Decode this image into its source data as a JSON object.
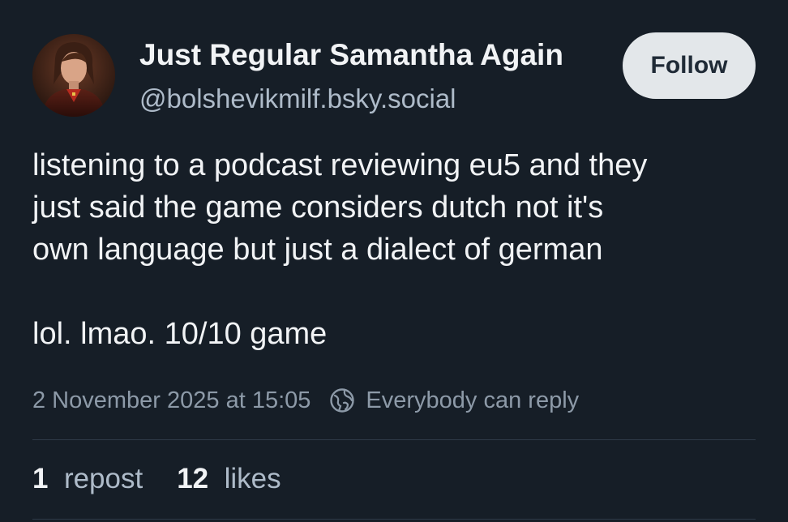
{
  "author": {
    "display_name": "Just Regular Samantha Again",
    "handle": "@bolshevikmilf.bsky.social"
  },
  "follow_label": "Follow",
  "post": {
    "paragraphs": [
      "listening to a podcast reviewing eu5 and they\njust said the game considers dutch not it's\nown language but just a dialect of german",
      "lol. lmao. 10/10 game"
    ],
    "timestamp": "2 November 2025 at 15:05",
    "reply_setting": "Everybody can reply"
  },
  "stats": {
    "reposts_count": "1",
    "reposts_label": "repost",
    "likes_count": "12",
    "likes_label": "likes"
  },
  "icons": {
    "reply_setting": "globe-icon"
  },
  "colors": {
    "background": "#161e27",
    "follow_button": "#e3e7ea",
    "text_primary": "#f1f3f5",
    "text_secondary": "#aebbc9"
  }
}
